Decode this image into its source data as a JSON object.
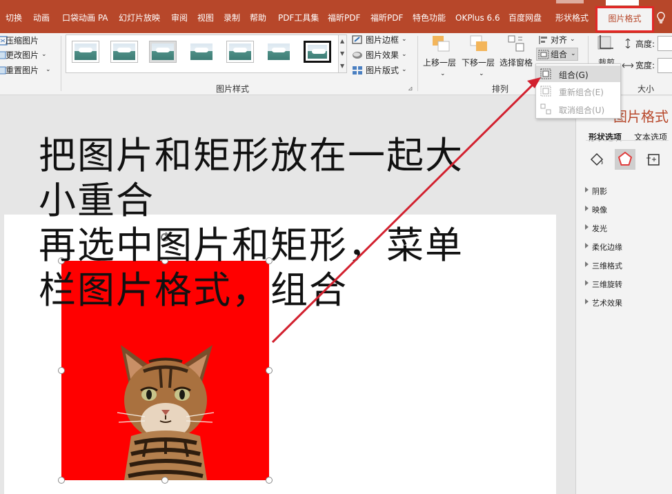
{
  "tabs": {
    "items": [
      "切换",
      "动画",
      "口袋动画 PA",
      "幻灯片放映",
      "审阅",
      "视图",
      "录制",
      "帮助",
      "PDF工具集",
      "福昕PDF",
      "福昕PDF",
      "特色功能",
      "OKPlus 6.6",
      "百度网盘",
      "形状格式"
    ],
    "active": "图片格式"
  },
  "ribbon": {
    "adjust": {
      "compress": "压缩图片",
      "change": "更改图片",
      "reset": "重置图片"
    },
    "styles": {
      "group_label": "图片样式",
      "border": "图片边框",
      "effects": "图片效果",
      "layout": "图片版式"
    },
    "arrange": {
      "group_label": "排列",
      "bring_forward": "上移一层",
      "send_backward": "下移一层",
      "selection_pane": "选择窗格",
      "align": "对齐",
      "group": "组合"
    },
    "size": {
      "group_label": "大小",
      "crop": "裁剪",
      "height": "高度:",
      "width": "宽度:"
    }
  },
  "dropdown": {
    "items": [
      {
        "label": "组合(G)",
        "enabled": true
      },
      {
        "label": "重新组合(E)",
        "enabled": false
      },
      {
        "label": "取消组合(U)",
        "enabled": false
      }
    ]
  },
  "slide": {
    "lines": [
      "把图片和矩形放在一起大",
      "小重合",
      "再选中图片和矩形，菜单",
      "栏图片格式，组合"
    ]
  },
  "pane": {
    "title": "图片格式",
    "tabs": [
      "形状选项",
      "文本选项"
    ],
    "sections": [
      "阴影",
      "映像",
      "发光",
      "柔化边缘",
      "三维格式",
      "三维旋转",
      "艺术效果"
    ]
  },
  "colors": {
    "accent": "#b7472a",
    "highlight": "#e32727",
    "rect": "#ff0000"
  }
}
